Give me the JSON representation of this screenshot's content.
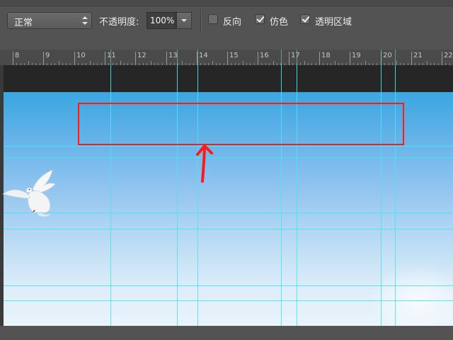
{
  "options_bar": {
    "blend_mode": "正常",
    "opacity_label": "不透明度:",
    "opacity_value": "100%",
    "checkboxes": [
      {
        "label": "反向",
        "checked": false
      },
      {
        "label": "仿色",
        "checked": true
      },
      {
        "label": "透明区域",
        "checked": true
      }
    ]
  },
  "ruler": {
    "labels": [
      "8",
      "9",
      "10",
      "11",
      "12",
      "13",
      "14",
      "15",
      "16",
      "17",
      "18",
      "19",
      "20",
      "21",
      "22"
    ]
  },
  "colors": {
    "annotation": "#ff1a1a",
    "guides": "#47e6f2",
    "sky_top": "#3ba6e0",
    "sky_bottom": "#eaf4fb"
  }
}
